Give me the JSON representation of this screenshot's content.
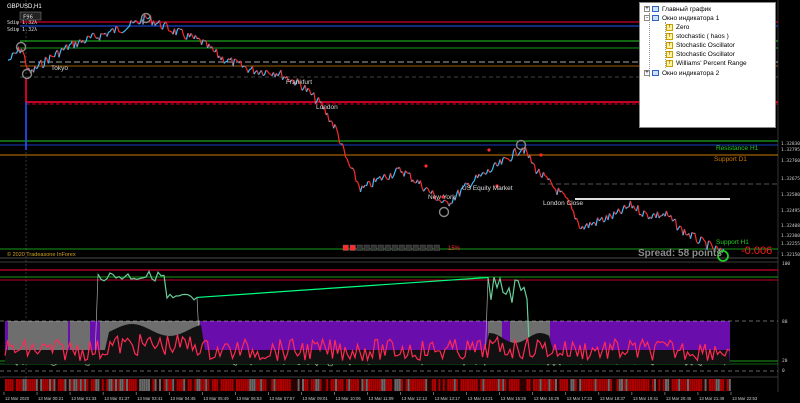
{
  "chart": {
    "symbol_title": "GBPUSD,H1",
    "info_lines": [
      "Sdiψ 1.32λ",
      "Sdiψ 1.32λ"
    ],
    "badge": "F96",
    "session_labels": [
      "Tokyo",
      "Frankfurt",
      "London",
      "New York",
      "US Equity Market",
      "London Close"
    ],
    "level_labels": [
      "Resistance H1",
      "Support D1",
      "Support H1"
    ],
    "spread_text": "Spread: 58 points",
    "spread_value": "-0.006",
    "progress_percent": 15,
    "progress_label": "15%",
    "copyright": "© 2020 Tradeasone InForex",
    "colors": {
      "background": "#000000",
      "candle_up": "#3fbfff",
      "candle_down": "#ff2a2a",
      "oscillator_fill": "#6a0dad",
      "oscillator_line": "#ff2a55",
      "stochastic_line": "#00ff7f",
      "level_red": "#ff0033",
      "level_green": "#22cc22",
      "level_blue": "#2255ff",
      "level_orange": "#cc7a00"
    }
  },
  "price_axis": {
    "labels": [
      "1.32830",
      "1.32795",
      "1.32760",
      "1.32675",
      "1.32580",
      "1.32495",
      "1.32408",
      "1.32300",
      "1.32255",
      "1.32150"
    ]
  },
  "osc_axis": {
    "labels": [
      "100",
      "80",
      "20",
      "0"
    ]
  },
  "time_axis": {
    "labels": [
      "12 Mar 2020",
      "13 Mar 00:21",
      "13 Mar 01:33",
      "13 Mar 01:37",
      "13 Mar 03:41",
      "13 Mar 04:45",
      "13 Mar 05:49",
      "13 Mar 06:53",
      "13 Mar 07:57",
      "13 Mar 09:01",
      "13 Mar 10:05",
      "13 Mar 11:09",
      "13 Mar 12:13",
      "13 Mar 13:17",
      "13 Mar 14:21",
      "13 Mar 15:25",
      "13 Mar 16:29",
      "13 Mar 17:33",
      "13 Mar 18:37",
      "13 Mar 19:41",
      "13 Mar 20:45",
      "13 Mar 21:49",
      "13 Mar 22:53"
    ]
  },
  "data_window": {
    "items": [
      {
        "label": "Главный график",
        "icon": "window-icon",
        "toggle": "+"
      },
      {
        "label": "Окно индикатора 1",
        "icon": "window-icon",
        "toggle": "-"
      },
      {
        "label": "Zero",
        "icon": "indicator-icon"
      },
      {
        "label": "stochastic ( haos )",
        "icon": "indicator-icon"
      },
      {
        "label": "Stochastic Oscillator",
        "icon": "indicator-icon"
      },
      {
        "label": "Stochastic Oscillator",
        "icon": "indicator-icon"
      },
      {
        "label": "Williams' Percent Range",
        "icon": "indicator-icon"
      },
      {
        "label": "Окно индикатора 2",
        "icon": "window-icon",
        "toggle": "+"
      }
    ]
  }
}
